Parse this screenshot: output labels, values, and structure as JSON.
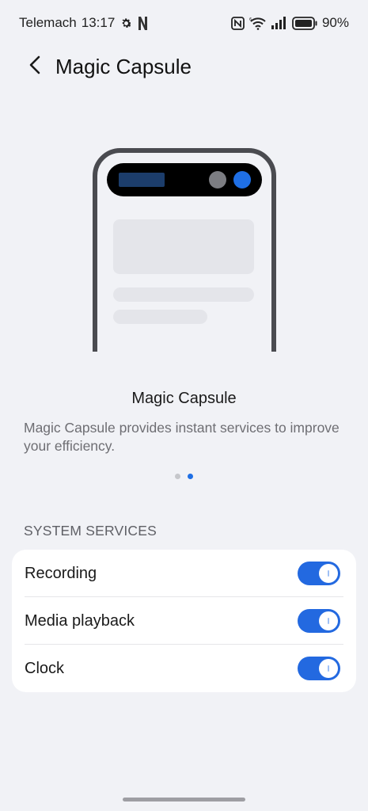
{
  "status_bar": {
    "carrier": "Telemach",
    "time": "13:17",
    "battery": "90%",
    "icons": [
      "gear-icon",
      "netflix-icon",
      "nfc-icon",
      "wifi-icon",
      "signal-icon",
      "battery-icon"
    ]
  },
  "header": {
    "title": "Magic Capsule",
    "back_icon": "chevron-left-icon"
  },
  "intro": {
    "title": "Magic Capsule",
    "description": "Magic Capsule provides instant services to improve your efficiency.",
    "pager": {
      "pages": 2,
      "active": 2
    }
  },
  "system_services": {
    "header": "SYSTEM SERVICES",
    "items": [
      {
        "label": "Recording",
        "enabled": true
      },
      {
        "label": "Media playback",
        "enabled": true
      },
      {
        "label": "Clock",
        "enabled": true
      }
    ]
  },
  "colors": {
    "accent": "#2369e0",
    "background": "#f1f2f6",
    "card": "#ffffff",
    "capsule_blue": "#1f6fe5",
    "phone_frame": "#4a4b50"
  }
}
